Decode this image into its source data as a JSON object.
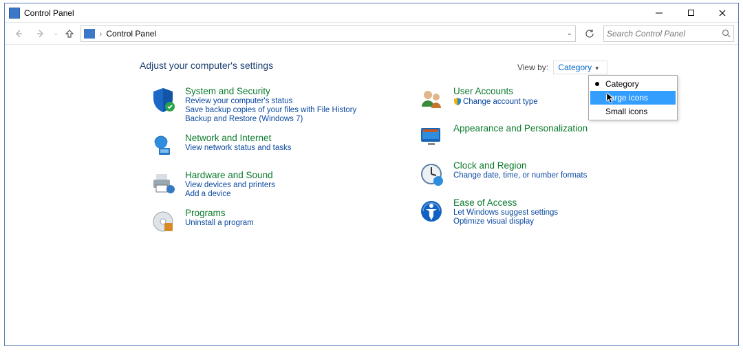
{
  "title": "Control Panel",
  "nav": {
    "pathLabel": "Control Panel"
  },
  "search": {
    "placeholder": "Search Control Panel"
  },
  "heading": "Adjust your computer's settings",
  "viewby": {
    "label": "View by:",
    "current": "Category",
    "options": [
      "Category",
      "Large icons",
      "Small icons"
    ]
  },
  "left": [
    {
      "title": "System and Security",
      "links": [
        "Review your computer's status",
        "Save backup copies of your files with File History",
        "Backup and Restore (Windows 7)"
      ]
    },
    {
      "title": "Network and Internet",
      "links": [
        "View network status and tasks"
      ]
    },
    {
      "title": "Hardware and Sound",
      "links": [
        "View devices and printers",
        "Add a device"
      ]
    },
    {
      "title": "Programs",
      "links": [
        "Uninstall a program"
      ]
    }
  ],
  "right": [
    {
      "title": "User Accounts",
      "links": [
        "Change account type"
      ]
    },
    {
      "title": "Appearance and Personalization",
      "links": []
    },
    {
      "title": "Clock and Region",
      "links": [
        "Change date, time, or number formats"
      ]
    },
    {
      "title": "Ease of Access",
      "links": [
        "Let Windows suggest settings",
        "Optimize visual display"
      ]
    }
  ]
}
